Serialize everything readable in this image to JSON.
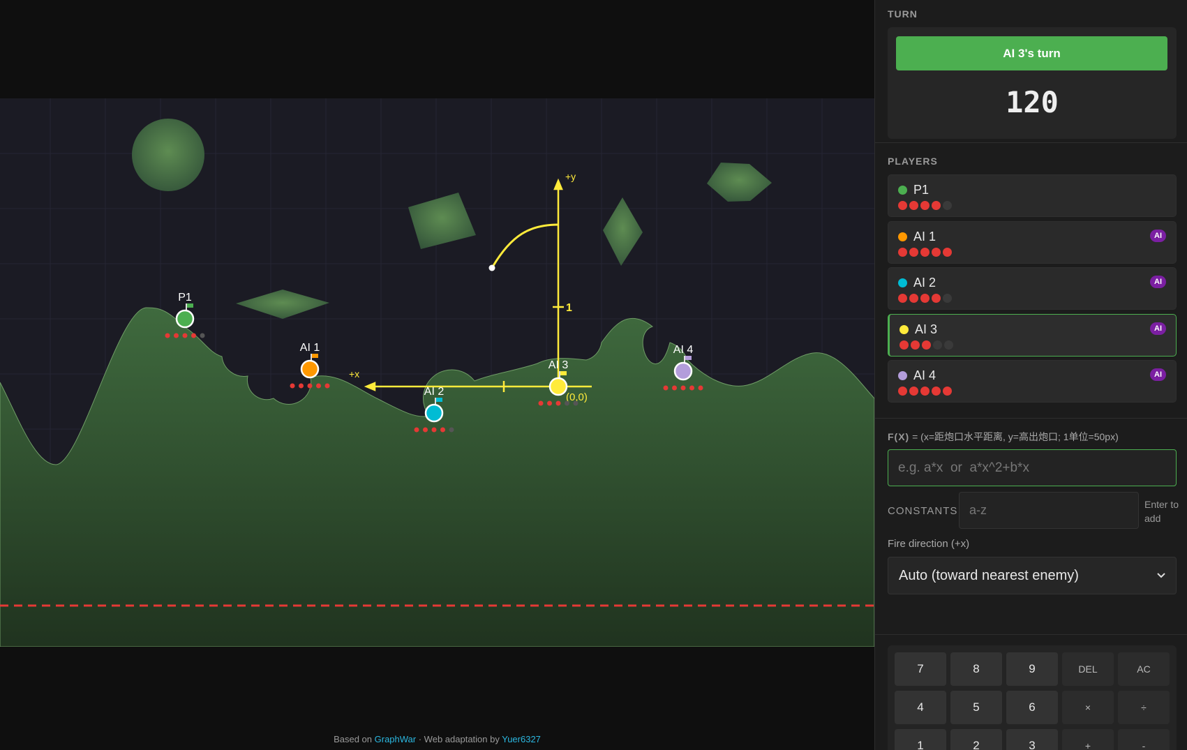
{
  "field": {
    "colors": {
      "background": "#1b1b24",
      "grid": "#262633",
      "terrain_top": "#3f6a3e",
      "terrain_bottom": "#213a23",
      "deadline": "#e53935",
      "axis": "#ffeb3b",
      "obstacle": "#4e7a45"
    },
    "axis_labels": {
      "x": "+x",
      "y": "+y",
      "tick": "1",
      "origin": "(0,0)"
    },
    "tanks": [
      {
        "name": "P1",
        "color": "#4caf50",
        "flag": "#4caf50",
        "hp": 4,
        "max_hp": 5
      },
      {
        "name": "AI 1",
        "color": "#ff9800",
        "flag": "#ff9800",
        "hp": 5,
        "max_hp": 5
      },
      {
        "name": "AI 2",
        "color": "#00bcd4",
        "flag": "#00bcd4",
        "hp": 4,
        "max_hp": 5
      },
      {
        "name": "AI 3",
        "color": "#ffeb3b",
        "flag": "#ffeb3b",
        "hp": 3,
        "max_hp": 5
      },
      {
        "name": "AI 4",
        "color": "#b39ddb",
        "flag": "#b39ddb",
        "hp": 5,
        "max_hp": 5
      }
    ]
  },
  "credits": {
    "prefix": "Based on",
    "link1": "GraphWar",
    "middle": "· Web adaptation by",
    "link2": "Yuer6327"
  },
  "panel": {
    "turn_label": "TURN",
    "turn_text": "AI 3's turn",
    "timer": "120",
    "players_label": "PLAYERS",
    "ai_badge": "AI",
    "fx_label": "F(X)",
    "fx_hint": "= (x=距炮口水平距离, y=高出炮口; 1单位=50px)",
    "fx_placeholder": "e.g. a*x  or  a*x^2+b*x",
    "fx_value": "",
    "constants_label": "CONSTANTS",
    "constants_placeholder": "a-z",
    "enter_hint": "Enter to add",
    "fire_label": "Fire direction (+x)",
    "fire_value": "Auto (toward nearest enemy)",
    "keys": [
      [
        "7",
        "8",
        "9",
        "DEL",
        "AC"
      ],
      [
        "4",
        "5",
        "6",
        "×",
        "÷"
      ],
      [
        "1",
        "2",
        "3",
        "+",
        "-"
      ]
    ]
  },
  "players": [
    {
      "name": "P1",
      "color": "#4caf50",
      "ai": false,
      "hp": 4,
      "max_hp": 5,
      "active": false
    },
    {
      "name": "AI 1",
      "color": "#ff9800",
      "ai": true,
      "hp": 5,
      "max_hp": 5,
      "active": false
    },
    {
      "name": "AI 2",
      "color": "#00bcd4",
      "ai": true,
      "hp": 4,
      "max_hp": 5,
      "active": false
    },
    {
      "name": "AI 3",
      "color": "#ffeb3b",
      "ai": true,
      "hp": 3,
      "max_hp": 5,
      "active": true
    },
    {
      "name": "AI 4",
      "color": "#b39ddb",
      "ai": true,
      "hp": 5,
      "max_hp": 5,
      "active": false
    }
  ]
}
